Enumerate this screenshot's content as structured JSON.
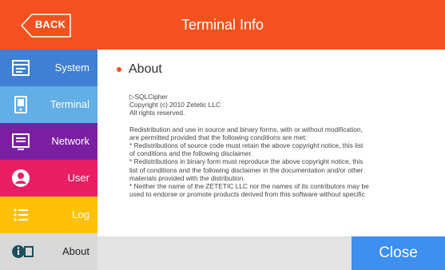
{
  "header": {
    "back_label": "BACK",
    "title": "Terminal Info",
    "color": "#f4511e"
  },
  "sidebar": {
    "items": [
      {
        "label": "System",
        "icon": "system-panel-icon",
        "color": "#3f7fd4"
      },
      {
        "label": "Terminal",
        "icon": "terminal-icon",
        "color": "#62aee6"
      },
      {
        "label": "Network",
        "icon": "network-icon",
        "color": "#7a1fa2"
      },
      {
        "label": "User",
        "icon": "user-icon",
        "color": "#e91e63"
      },
      {
        "label": "Log",
        "icon": "log-list-icon",
        "color": "#ffc107"
      },
      {
        "label": "About",
        "icon": "info-icon",
        "color": "#d9d9d9"
      }
    ]
  },
  "content": {
    "section_title": "About",
    "lines_intro": [
      "▷SQLCipher",
      "Copyright (c) 2010 Zetetic LLC",
      "All rights reserved."
    ],
    "lines_license": [
      "Redistribution and use in source and binary forms, with or without modification,",
      "are permitted provided that the following conditions are met:",
      "* Redistributions of source code must retain the above copyright notice, this list",
      "of conditions and the following disclaimer.",
      "* Redistributions in binary form must reproduce the above copyright notice, this",
      "list of conditions and the following disclaimer in the documentation and/or other",
      "materials provided with the distribution.",
      "* Neither the name of the ZETETIC LLC nor the names of its contributors may be",
      "used to endorse or promote products derived from this software without specific"
    ]
  },
  "footer": {
    "close_label": "Close",
    "close_color": "#3d8ff0"
  }
}
